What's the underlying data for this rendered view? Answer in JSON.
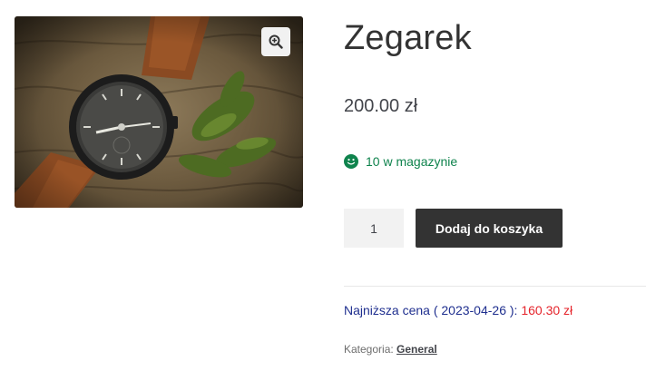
{
  "product": {
    "title": "Zegarek",
    "price": "200.00 zł",
    "stock_text": "10 w magazynie",
    "quantity": "1",
    "add_to_cart_label": "Dodaj do koszyka",
    "lowest_price_label": "Najniższa cena ( 2023-04-26 ):",
    "lowest_price_value": "160.30 zł",
    "category_label": "Kategoria:",
    "category_link": "General"
  },
  "gallery": {
    "zoom_icon": "zoom-in-icon",
    "image_subject": "watch-photo"
  },
  "colors": {
    "stock_green": "#0f834d",
    "button_dark": "#333333",
    "lowest_price_blue": "#1f2f8f",
    "lowest_price_red": "#e5242b"
  }
}
